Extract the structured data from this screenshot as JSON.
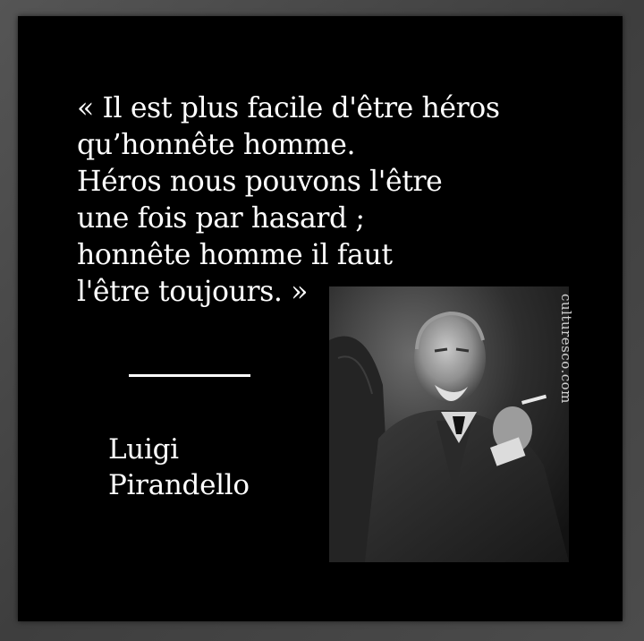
{
  "quote": {
    "lines": [
      "« Il est plus facile d'être héros",
      "qu’honnête homme.",
      "Héros nous pouvons l'être",
      "une fois par hasard ;",
      "honnête homme il faut",
      "l'être toujours. »"
    ]
  },
  "author": {
    "first_name": "Luigi",
    "last_name": "Pirandello"
  },
  "photo": {
    "subject": "portrait-photo"
  },
  "watermark": {
    "text": "culturesco.com"
  },
  "colors": {
    "background": "#000000",
    "text": "#ffffff",
    "frame": "#4a4a4a"
  }
}
